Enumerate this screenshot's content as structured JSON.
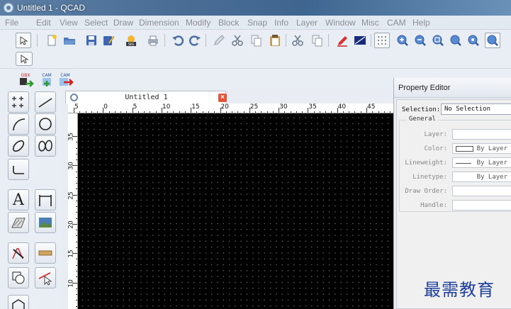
{
  "window": {
    "title": "Untitled 1 - QCAD"
  },
  "menu": [
    "File",
    "Edit",
    "View",
    "Select",
    "Draw",
    "Dimension",
    "Modify",
    "Block",
    "Snap",
    "Info",
    "Layer",
    "Window",
    "Misc",
    "CAM",
    "Help"
  ],
  "cam_toolbar": {
    "export_gbx_label": "GBX",
    "cam_label_1": "CAM",
    "cam_label_2": "CAM"
  },
  "document": {
    "tab_title": "Untitled 1",
    "ruler_top_labels": [
      "5",
      "0",
      "5",
      "10",
      "15",
      "20",
      "25",
      "30",
      "35",
      "40",
      "45"
    ],
    "ruler_left_labels": [
      "35",
      "30",
      "25",
      "20",
      "15",
      "10"
    ]
  },
  "palette": {
    "text_tool_label": "A"
  },
  "property_editor": {
    "title": "Property Editor",
    "selection_label": "Selection:",
    "selection_value": "No Selection",
    "general_title": "General",
    "rows": [
      {
        "label": "Layer:",
        "value": ""
      },
      {
        "label": "Color:",
        "value": "By Layer"
      },
      {
        "label": "Lineweight:",
        "value": "By Layer"
      },
      {
        "label": "Linetype:",
        "value": "By Layer"
      },
      {
        "label": "Draw Order:",
        "value": ""
      },
      {
        "label": "Handle:",
        "value": ""
      }
    ]
  },
  "watermark": "最需教育",
  "colors": {
    "canvas": "#000000",
    "grid": "#555555",
    "titlebar": "#4a6d95",
    "watermark": "#1d3f9a"
  }
}
